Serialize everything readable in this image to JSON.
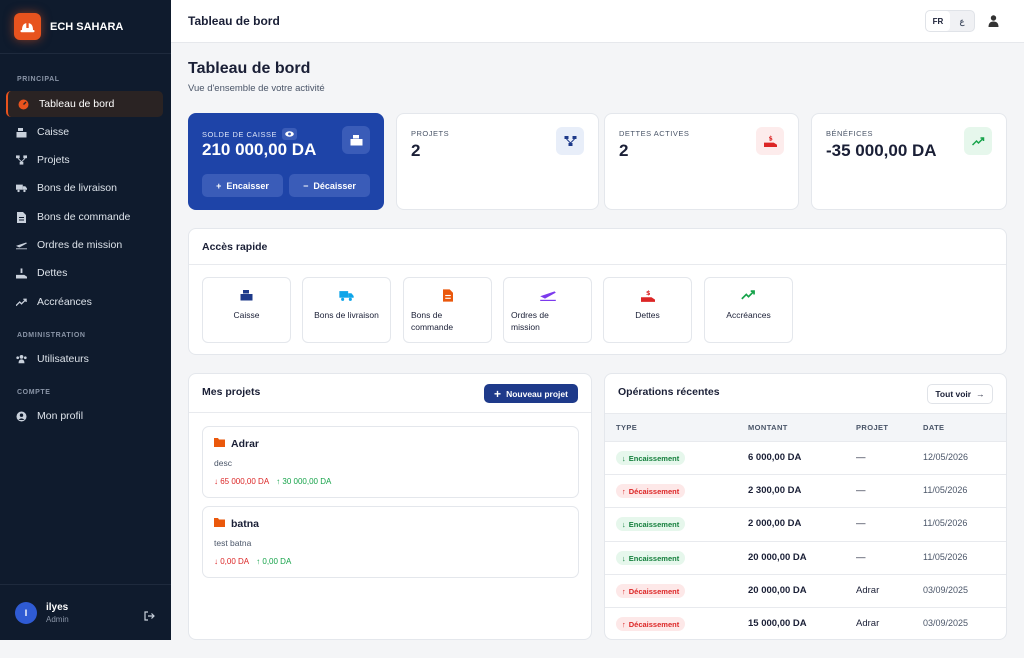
{
  "brand": {
    "name": "ECH SAHARA"
  },
  "sidebar": {
    "sections": [
      "PRINCIPAL",
      "ADMINISTRATION",
      "COMPTE"
    ],
    "items": [
      {
        "label": "Tableau de bord",
        "icon": "gauge-icon"
      },
      {
        "label": "Caisse",
        "icon": "cash-register-icon"
      },
      {
        "label": "Projets",
        "icon": "project-diagram-icon"
      },
      {
        "label": "Bons de livraison",
        "icon": "truck-icon"
      },
      {
        "label": "Bons de commande",
        "icon": "file-invoice-icon"
      },
      {
        "label": "Ordres de mission",
        "icon": "plane-icon"
      },
      {
        "label": "Dettes",
        "icon": "hand-holding-dollar-icon"
      },
      {
        "label": "Accréances",
        "icon": "trend-up-icon"
      },
      {
        "label": "Utilisateurs",
        "icon": "users-icon"
      },
      {
        "label": "Mon profil",
        "icon": "user-circle-icon"
      }
    ]
  },
  "user": {
    "initial": "I",
    "name": "ilyes",
    "role": "Admin"
  },
  "topbar": {
    "title": "Tableau de bord",
    "lang_fr": "FR",
    "lang_ar": "ع"
  },
  "page": {
    "title": "Tableau de bord",
    "subtitle": "Vue d'ensemble de votre activité"
  },
  "stats": {
    "cash": {
      "label": "SOLDE DE CAISSE",
      "value": "210 000,00 DA",
      "in_label": "Encaisser",
      "out_label": "Décaisser"
    },
    "projects": {
      "label": "PROJETS",
      "value": "2"
    },
    "debts": {
      "label": "DETTES ACTIVES",
      "value": "2"
    },
    "profits": {
      "label": "BÉNÉFICES",
      "value": "-35 000,00 DA"
    }
  },
  "quick": {
    "title": "Accès rapide",
    "items": [
      "Caisse",
      "Bons de livraison",
      "Bons de commande",
      "Ordres de mission",
      "Dettes",
      "Accréances"
    ]
  },
  "projects": {
    "title": "Mes projets",
    "new_label": "Nouveau projet",
    "items": [
      {
        "name": "Adrar",
        "desc": "desc",
        "out": "65 000,00 DA",
        "in": "30 000,00 DA"
      },
      {
        "name": "batna",
        "desc": "test batna",
        "out": "0,00 DA",
        "in": "0,00 DA"
      }
    ]
  },
  "operations": {
    "title": "Opérations récentes",
    "all_label": "Tout voir",
    "headers": [
      "TYPE",
      "MONTANT",
      "PROJET",
      "DATE"
    ],
    "rows": [
      {
        "type": "Encaissement",
        "amount": "6 000,00 DA",
        "project": "—",
        "date": "12/05/2026"
      },
      {
        "type": "Décaissement",
        "amount": "2 300,00 DA",
        "project": "—",
        "date": "11/05/2026"
      },
      {
        "type": "Encaissement",
        "amount": "2 000,00 DA",
        "project": "—",
        "date": "11/05/2026"
      },
      {
        "type": "Encaissement",
        "amount": "20 000,00 DA",
        "project": "—",
        "date": "11/05/2026"
      },
      {
        "type": "Décaissement",
        "amount": "20 000,00 DA",
        "project": "Adrar",
        "date": "03/09/2025"
      },
      {
        "type": "Décaissement",
        "amount": "15 000,00 DA",
        "project": "Adrar",
        "date": "03/09/2025"
      }
    ]
  },
  "colors": {
    "accent": "#e8531e",
    "primary": "#1e44a8",
    "sidebar": "#0f1b2d",
    "income": "#16a34a",
    "expense": "#dc2626"
  }
}
